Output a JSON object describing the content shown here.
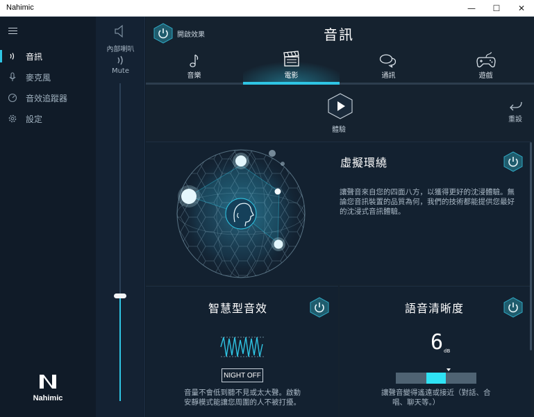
{
  "window": {
    "title": "Nahimic",
    "controls": {
      "minimize": "—",
      "maximize": "☐",
      "close": "✕"
    }
  },
  "sidebar": {
    "items": [
      {
        "label": "音訊",
        "icon": "audio-wave-icon",
        "active": true
      },
      {
        "label": "麥克風",
        "icon": "microphone-icon",
        "active": false
      },
      {
        "label": "音效追蹤器",
        "icon": "sound-tracker-icon",
        "active": false
      },
      {
        "label": "設定",
        "icon": "gear-icon",
        "active": false
      }
    ],
    "logo_text": "Nahimic"
  },
  "volume": {
    "device_label": "內部喇叭",
    "mute_label": "Mute",
    "level": 0.33
  },
  "header": {
    "effects_label": "開啟效果",
    "title": "音訊"
  },
  "tabs": [
    {
      "label": "音樂",
      "icon": "music-note-icon"
    },
    {
      "label": "電影",
      "icon": "clapperboard-icon",
      "active": true
    },
    {
      "label": "通訊",
      "icon": "chat-bubble-icon"
    },
    {
      "label": "遊戲",
      "icon": "gamepad-icon"
    }
  ],
  "toolbar": {
    "play_label": "體驗",
    "reset_label": "重設"
  },
  "surround": {
    "title": "虛擬環繞",
    "description_lines": [
      "讓聲音來自您的四面八方，以獲得更好的沈浸體驗。無",
      "論您音訊裝置的品質為何，我們的技術都能提供您最好",
      "的沈浸式音訊體驗。"
    ]
  },
  "smart_volume": {
    "title": "智慧型音效",
    "mode_button": "NIGHT OFF",
    "description_lines": [
      "音量不會低到聽不見或太大聲。啟動",
      "安靜模式能讓您周圍的人不被打擾。"
    ]
  },
  "voice_clarity": {
    "title": "語音清晰度",
    "value": "6",
    "unit": "dB",
    "level": 0.6,
    "description_lines": [
      "讓聲音變得遙遠或接近（對話、合",
      "唱、聊天等。）"
    ]
  },
  "colors": {
    "accent": "#2fc5e4",
    "background": "#0f1a27",
    "panel": "#132130",
    "power_hex": "#1f5c6d"
  }
}
